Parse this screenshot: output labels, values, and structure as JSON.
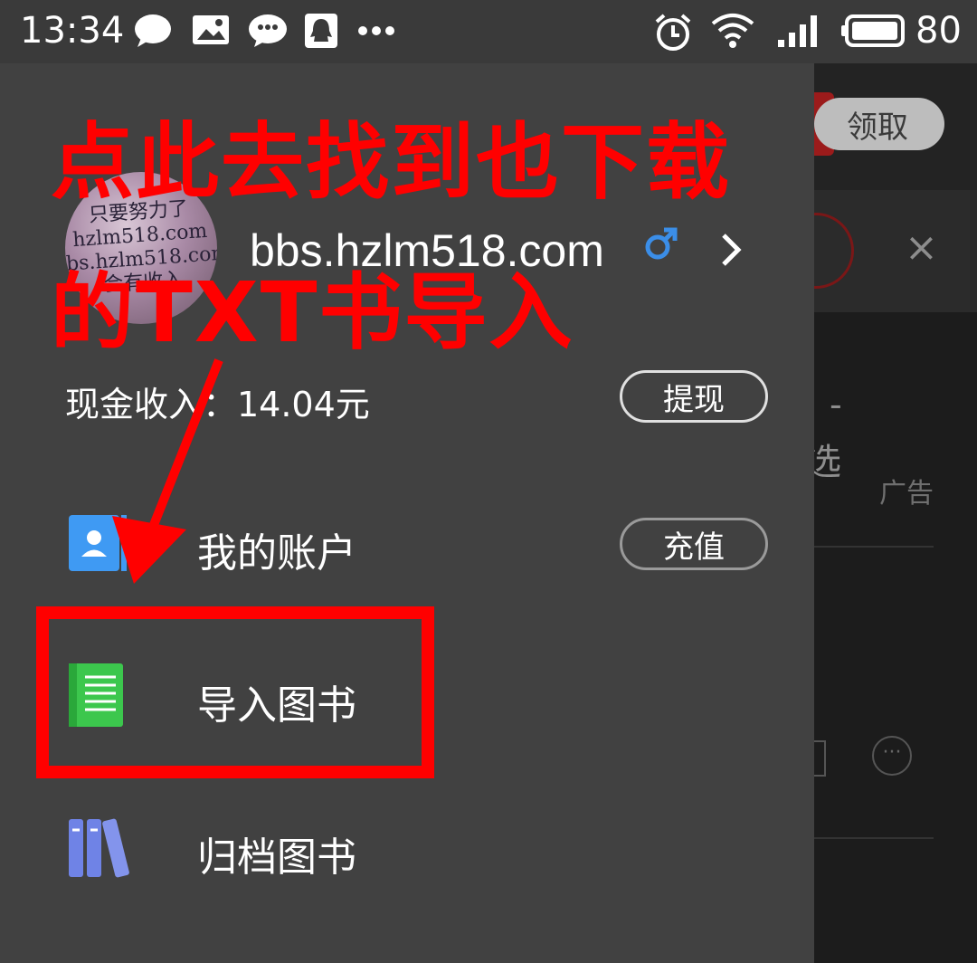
{
  "status_bar": {
    "time": "13:34",
    "battery": "80"
  },
  "background": {
    "claim_button": "领取",
    "close": "×",
    "dash": "-",
    "partial_char": "选",
    "ad_label": "广告",
    "more": "···"
  },
  "drawer": {
    "avatar_watermark": [
      "只要努力了",
      "hzlm518.com",
      "bbs.hzlm518.com",
      "会有收入"
    ],
    "profile": {
      "username": "bbs.hzlm518.com",
      "gender_symbol": "♂"
    },
    "income": {
      "label": "现金收入：14.04元",
      "withdraw_button": "提现"
    },
    "menu": [
      {
        "label": "我的账户",
        "icon": "account-icon",
        "action": "充值"
      },
      {
        "label": "导入图书",
        "icon": "import-book-icon"
      },
      {
        "label": "归档图书",
        "icon": "archive-books-icon"
      }
    ]
  },
  "annotation": {
    "line1": "点此去找到也下载",
    "line2": "的TXT书导入"
  },
  "colors": {
    "drawer_bg": "#414141",
    "annotation": "#ff0000",
    "account_icon": "#3f9af3",
    "import_icon": "#3cc74d",
    "archive_icon": "#6f83e6"
  }
}
